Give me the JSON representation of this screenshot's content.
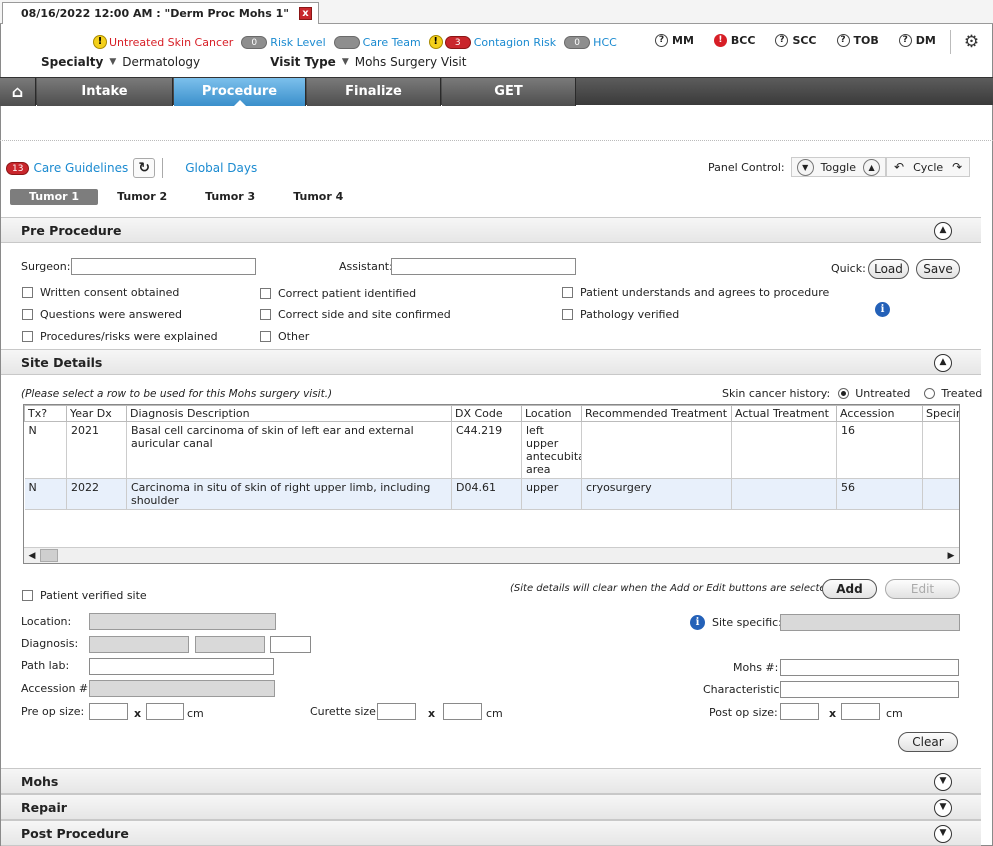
{
  "document_tab": {
    "title": "08/16/2022 12:00 AM : \"Derm Proc Mohs 1\"",
    "close_glyph": "x"
  },
  "alerts": {
    "untreated_skin_cancer": "Untreated Skin Cancer",
    "risk_count": "0",
    "risk_level": "Risk Level",
    "care_team_count": "",
    "care_team": "Care Team",
    "contagion_count": "3",
    "contagion_risk": "Contagion Risk",
    "hcc_count": "0",
    "hcc": "HCC"
  },
  "indicators": [
    {
      "label": "MM",
      "icon": "question-icon"
    },
    {
      "label": "BCC",
      "icon": "alert-icon"
    },
    {
      "label": "SCC",
      "icon": "question-icon"
    },
    {
      "label": "TOB",
      "icon": "question-icon"
    },
    {
      "label": "DM",
      "icon": "question-icon"
    }
  ],
  "header": {
    "specialty_label": "Specialty",
    "specialty_value": "Dermatology",
    "visit_type_label": "Visit Type",
    "visit_type_value": "Mohs Surgery Visit"
  },
  "nav": {
    "tabs": [
      "Intake",
      "Procedure",
      "Finalize",
      "GET"
    ],
    "active": "Procedure"
  },
  "care": {
    "count": "13",
    "care_guidelines": "Care Guidelines",
    "global_days": "Global Days"
  },
  "panel_control": {
    "label": "Panel Control:",
    "toggle": "Toggle",
    "cycle": "Cycle"
  },
  "tumors": [
    "Tumor 1",
    "Tumor 2",
    "Tumor 3",
    "Tumor 4"
  ],
  "pre_procedure": {
    "title": "Pre Procedure",
    "surgeon_label": "Surgeon:",
    "surgeon_value": "",
    "assistant_label": "Assistant:",
    "assistant_value": "",
    "quick_label": "Quick:",
    "load": "Load",
    "save": "Save",
    "checks": [
      "Written consent obtained",
      "Questions were answered",
      "Procedures/risks were explained",
      "Correct patient identified",
      "Correct side and site confirmed",
      "Other",
      "Patient understands and agrees to procedure",
      "Pathology verified"
    ]
  },
  "site_details": {
    "title": "Site Details",
    "hint": "(Please select a row to be used for this Mohs surgery visit.)",
    "history_label": "Skin cancer history:",
    "history_options": [
      "Untreated",
      "Treated"
    ],
    "columns": [
      "Tx?",
      "Year Dx",
      "Diagnosis Description",
      "DX Code",
      "Location",
      "Recommended Treatment",
      "Actual Treatment",
      "Accession",
      "Specim"
    ],
    "rows": [
      [
        "N",
        "2021",
        "Basal cell carcinoma of skin of left ear and external auricular canal",
        "C44.219",
        "left upper antecubita area",
        "",
        "",
        "16",
        ""
      ],
      [
        "N",
        "2022",
        "Carcinoma in situ of skin of right upper limb, including shoulder",
        "D04.61",
        "upper",
        "cryosurgery",
        "",
        "56",
        ""
      ]
    ],
    "patient_verified_site": "Patient verified site",
    "clear_note": "(Site details will clear when the Add or Edit buttons are selected.)",
    "add": "Add",
    "edit": "Edit",
    "location_label": "Location:",
    "diagnosis_label": "Diagnosis:",
    "path_lab_label": "Path lab:",
    "accession_label": "Accession #:",
    "pre_op_label": "Pre op size:",
    "curette_label": "Curette size:",
    "post_op_label": "Post op size:",
    "x": "x",
    "cm": "cm",
    "site_specific_label": "Site specific:",
    "mohs_label": "Mohs #:",
    "characteristic_label": "Characteristic:",
    "clear": "Clear"
  },
  "sections_collapsed": [
    "Mohs",
    "Repair",
    "Post Procedure"
  ]
}
